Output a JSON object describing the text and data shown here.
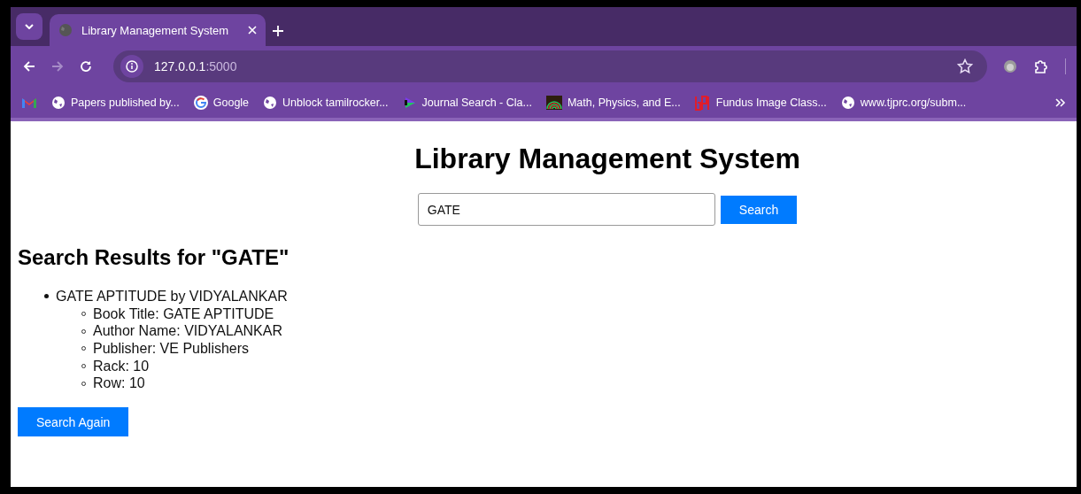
{
  "tab": {
    "title": "Library Management System",
    "selected": true
  },
  "address": {
    "host": "127.0.0.1",
    "port": ":5000"
  },
  "bookmarks": [
    {
      "kind": "gmail"
    },
    {
      "kind": "globe",
      "label": "Papers published by..."
    },
    {
      "kind": "google",
      "label": "Google"
    },
    {
      "kind": "globe",
      "label": "Unblock tamilrocker..."
    },
    {
      "kind": "journal",
      "label": "Journal Search - Cla..."
    },
    {
      "kind": "math",
      "label": "Math, Physics, and E..."
    },
    {
      "kind": "fundus",
      "label": "Fundus Image Class..."
    },
    {
      "kind": "globe",
      "label": "www.tjprc.org/subm..."
    }
  ],
  "page": {
    "title": "Library Management System",
    "search": {
      "value": "GATE",
      "button": "Search"
    },
    "results_heading": "Search Results for \"GATE\"",
    "results": [
      {
        "heading": "GATE APTITUDE by VIDYALANKAR",
        "details": [
          "Book Title: GATE APTITUDE",
          "Author Name: VIDYALANKAR",
          "Publisher: VE Publishers",
          "Rack: 10",
          "Row: 10"
        ]
      }
    ],
    "again_button": "Search Again"
  }
}
